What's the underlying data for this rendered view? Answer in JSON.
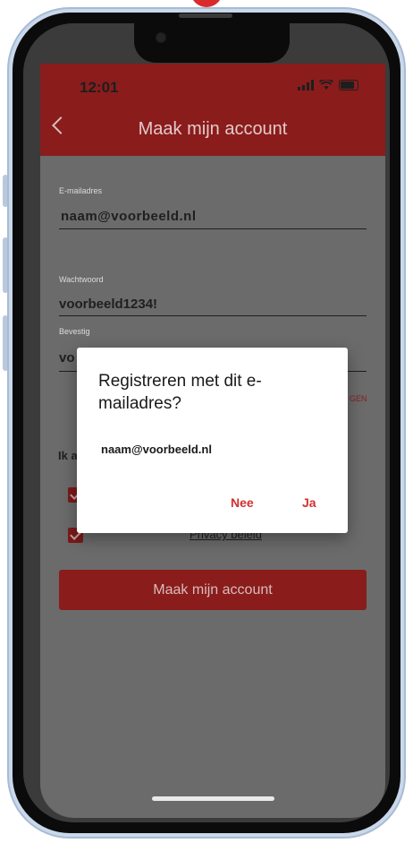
{
  "status_bar": {
    "time": "12:01",
    "signal_icon": "signal-bars-icon",
    "wifi_icon": "wifi-icon",
    "battery_icon": "battery-icon"
  },
  "header": {
    "title": "Maak mijn account",
    "back_icon": "chevron-left-icon"
  },
  "form": {
    "email_label": "E-mailadres",
    "email_value": "naam@voorbeeld.nl",
    "password_label": "Wachtwoord",
    "password_value": "voorbeeld1234!",
    "confirm_label": "Bevestig",
    "confirm_value_visible": "vo",
    "toggle_suffix": "GEN",
    "agree_prefix": "Ik a",
    "privacy_link": "Privacy beleid",
    "submit_label": "Maak mijn account"
  },
  "dialog": {
    "title": "Registreren met dit e-mailadres?",
    "message": "naam@voorbeeld.nl",
    "no_label": "Nee",
    "yes_label": "Ja"
  },
  "colors": {
    "header": "#8a1c1c",
    "accent": "#d32f2f",
    "overlay": "#6b6b6b"
  }
}
